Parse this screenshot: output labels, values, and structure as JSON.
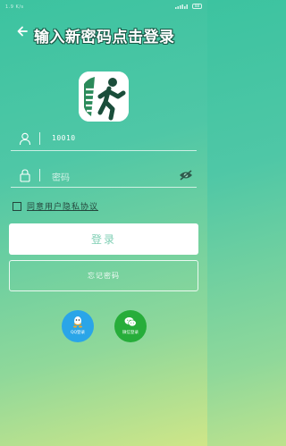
{
  "status_bar": {
    "left": "1.9 K/s",
    "battery": "88"
  },
  "header": {
    "title": "输入新密码点击登录"
  },
  "login_form": {
    "username_value": "10010",
    "password_placeholder": "密码",
    "agreement_label": "同意用户隐私协议",
    "agreement_checked": false
  },
  "buttons": {
    "login_label": "登录",
    "forgot_label": "忘记密码"
  },
  "social_login": {
    "qq_label": "QQ登录",
    "wechat_label": "微信登录"
  },
  "colors": {
    "background_top": "#3cc3a0",
    "background_bottom": "#cfe688",
    "qq_blue": "#2aa5e8",
    "wechat_green": "#27ad3a",
    "login_text": "#7fcfb4"
  },
  "icons": [
    "back-arrow-icon",
    "user-icon",
    "lock-icon",
    "eye-hidden-icon",
    "qq-icon",
    "wechat-icon",
    "runner-logo-icon"
  ]
}
